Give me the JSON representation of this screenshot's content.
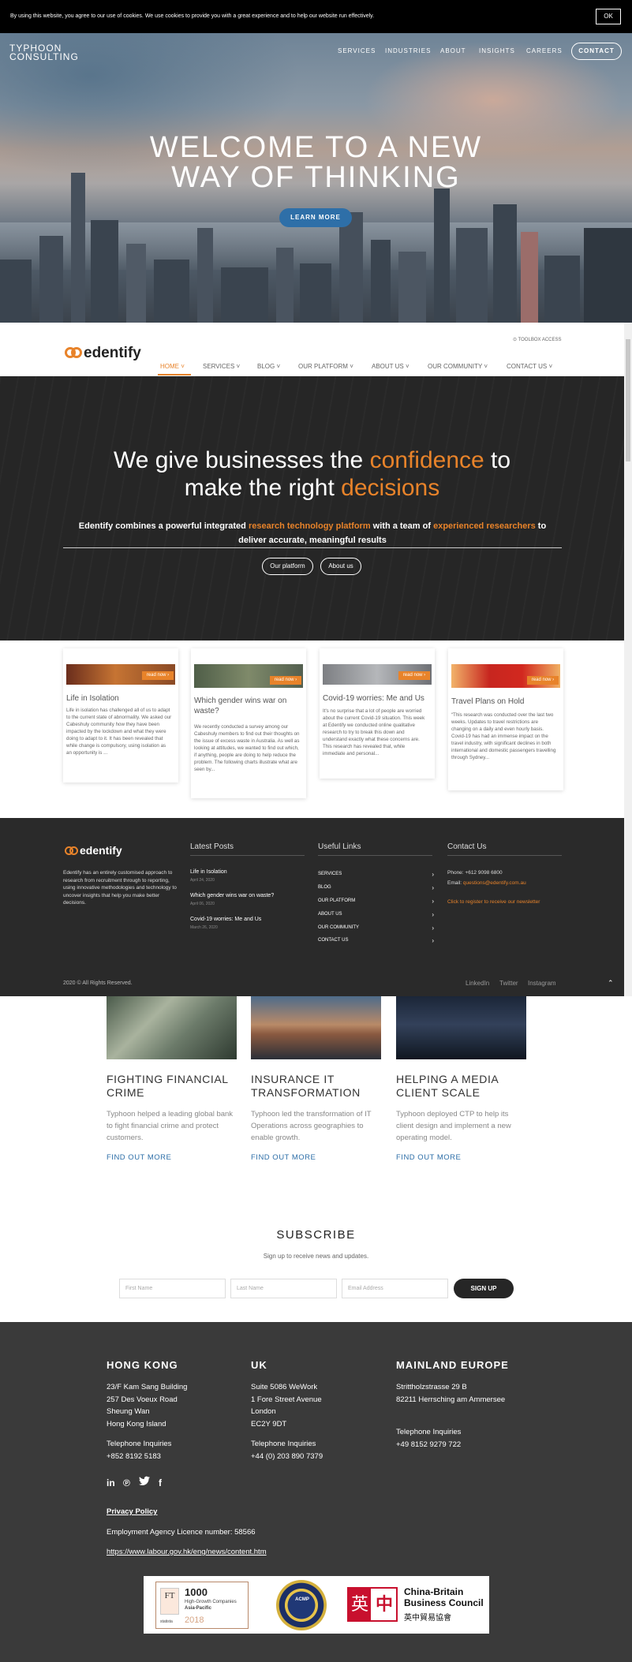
{
  "cookie_bar": {
    "text": "By using this website, you agree to our use of cookies. We use cookies to provide you with a great experience and to help our website run effectively.",
    "ok_label": "OK"
  },
  "typhoon_header": {
    "logo_line1": "TYPHOON",
    "logo_line2": "CONSULTING",
    "nav": [
      "SERVICES",
      "INDUSTRIES",
      "ABOUT",
      "INSIGHTS",
      "CAREERS"
    ],
    "contact_label": "CONTACT"
  },
  "hero": {
    "title_line1": "WELCOME TO A NEW",
    "title_line2": "WAY OF THINKING",
    "cta_label": "LEARN MORE"
  },
  "edentify": {
    "logo_text": "edentify",
    "toolbox_link": "⊙ TOOLBOX ACCESS",
    "nav": [
      {
        "label": "HOME ˅",
        "active": true
      },
      {
        "label": "SERVICES ˅",
        "active": false
      },
      {
        "label": "BLOG ˅",
        "active": false
      },
      {
        "label": "OUR PLATFORM ˅",
        "active": false
      },
      {
        "label": "ABOUT US ˅",
        "active": false
      },
      {
        "label": "OUR COMMUNITY ˅",
        "active": false
      },
      {
        "label": "CONTACT US ˅",
        "active": false
      }
    ],
    "headline": {
      "part1": "We give businesses the ",
      "highlight1": "confidence",
      "part2": " to",
      "part3": "make the right ",
      "highlight2": "decisions"
    },
    "subhead": {
      "part1": "Edentify combines a powerful integrated ",
      "highlight1": "research technology platform",
      "part2": " with a team of ",
      "highlight2": "experienced researchers",
      "part3": " to",
      "line2": "deliver accurate, meaningful results"
    },
    "buttons": [
      "Our platform",
      "About us"
    ],
    "read_now_label": "read now ›",
    "cards": [
      {
        "title": "Life in Isolation",
        "text": "Life in isolation has challenged all of us to adapt to the current state of abnormality. We asked our Cabeshuly community how they have been impacted by the lockdown and what they were doing to adapt to it. It has been revealed that while change is compulsory, using isolation as an opportunity is ..."
      },
      {
        "title": "Which gender wins war on waste?",
        "text": "We recently conducted a survey among our Cabeshuly members to find out their thoughts on the issue of excess waste in Australia. As well as looking at attitudes, we wanted to find out which, if anything, people are doing to help reduce the problem. The following charts illustrate what are seen by..."
      },
      {
        "title": "Covid-19 worries: Me and Us",
        "text": "It's no surprise that a lot of people are worried about the current Covid-19 situation. This week at Edentify we conducted online qualitative research to try to break this down and understand exactly what these concerns are. This research has revealed that, while immediate and personal..."
      },
      {
        "title": "Travel Plans on Hold",
        "text": "“This research was conducted over the last two weeks. Updates to travel restrictions are changing on a daily and even hourly basis. Covid-19 has had an immense impact on the travel industry, with significant declines in both international and domestic passengers travelling through Sydney..."
      }
    ],
    "footer": {
      "about": "Edentify has an entirely customised approach to research from recruitment through to reporting, using innovative methodologies and technology to uncover insights that help you make better decisions.",
      "latest_posts_heading": "Latest Posts",
      "posts": [
        {
          "title": "Life in Isolation",
          "date": "April 24, 2020"
        },
        {
          "title": "Which gender wins war on waste?",
          "date": "April 06, 2020"
        },
        {
          "title": "Covid-19 worries: Me and Us",
          "date": "March 26, 2020"
        }
      ],
      "useful_links_heading": "Useful Links",
      "links": [
        "SERVICES",
        "BLOG",
        "OUR PLATFORM",
        "ABOUT US",
        "OUR COMMUNITY",
        "CONTACT US"
      ],
      "contact_heading": "Contact Us",
      "phone_label": "Phone: +612 9098 6800",
      "email_prefix": "Email: ",
      "email": "questions@edentify.com.au",
      "newsletter": "Click to register to receive our newsletter",
      "copyright": "2020 © All Rights Reserved.",
      "social": [
        "LinkedIn",
        "Twitter",
        "Instagram"
      ]
    }
  },
  "case_studies": [
    {
      "title_line1": "FIGHTING FINANCIAL",
      "title_line2": "CRIME",
      "text": "Typhoon helped a leading global bank to fight financial crime and protect customers.",
      "link": "FIND OUT MORE"
    },
    {
      "title_line1": "INSURANCE IT",
      "title_line2": "TRANSFORMATION",
      "text": "Typhoon led the transformation of IT Operations across geographies to enable growth.",
      "link": "FIND OUT MORE"
    },
    {
      "title_line1": "HELPING A MEDIA",
      "title_line2": "CLIENT SCALE",
      "text": "Typhoon deployed CTP to help its client design and implement a new operating model.",
      "link": "FIND OUT MORE"
    }
  ],
  "subscribe": {
    "title": "SUBSCRIBE",
    "text": "Sign up to receive news and updates.",
    "placeholders": [
      "First Name",
      "Last Name",
      "Email Address"
    ],
    "button": "SIGN UP"
  },
  "offices": [
    {
      "heading": "HONG KONG",
      "address": [
        "23/F Kam Sang Building",
        "257 Des Voeux Road",
        "Sheung Wan",
        "Hong Kong Island"
      ],
      "phone_label": "Telephone Inquiries",
      "phone": "+852 8192 5183"
    },
    {
      "heading": "UK",
      "address": [
        "Suite 5086 WeWork",
        "1 Fore Street Avenue",
        "London",
        "EC2Y 9DT"
      ],
      "phone_label": "Telephone Inquiries",
      "phone": "+44 (0) 203 890 7379"
    },
    {
      "heading": "MAINLAND EUROPE",
      "address": [
        "Strittholzstrasse 29 B",
        "82211 Herrsching am Ammersee"
      ],
      "phone_label": "Telephone Inquiries",
      "phone": "+49 8152 9279 722"
    }
  ],
  "footer": {
    "social_icons": [
      "linkedin-icon",
      "pinterest-icon",
      "twitter-icon",
      "facebook-icon"
    ],
    "privacy": "Privacy Policy",
    "licence": "Employment Agency Licence number: 58566",
    "labour_link": "https://www.labour.gov.hk/eng/news/content.htm"
  },
  "logos": {
    "ft_badge": "FT",
    "ft_number": "1000",
    "ft_line2": "High-Growth Companies",
    "ft_line3": "Asia-Pacific",
    "ft_year": "2018",
    "ft_partner": "statista",
    "acmp_text": "ACMP",
    "cbbc_char1": "英",
    "cbbc_char2": "中",
    "cbbc_line1": "China-Britain",
    "cbbc_line2": "Business Council",
    "cbbc_line3": "英中貿易協會"
  },
  "colors": {
    "accent_orange": "#e8832a",
    "typhoon_blue": "#2e6fa8",
    "dark": "#2a2a2a"
  }
}
